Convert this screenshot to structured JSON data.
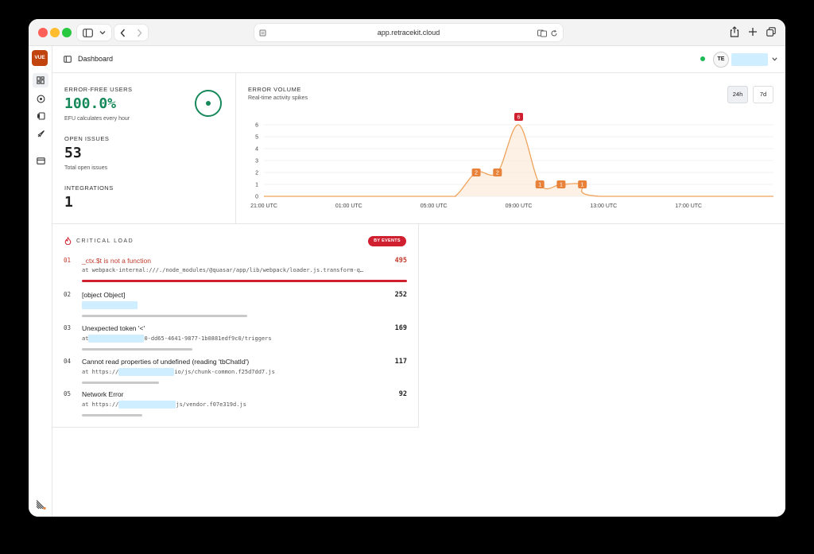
{
  "browser": {
    "url": "app.retracekit.cloud"
  },
  "sidebar": {
    "logo_text": "VUE"
  },
  "header": {
    "title": "Dashboard",
    "avatar_initials": "TE"
  },
  "stats": {
    "error_free": {
      "label": "ERROR-FREE USERS",
      "value": "100.0%",
      "sub": "EFU calculates every hour"
    },
    "open_issues": {
      "label": "OPEN ISSUES",
      "value": "53",
      "sub": "Total open issues"
    },
    "integrations": {
      "label": "INTEGRATIONS",
      "value": "1"
    }
  },
  "colors": {
    "accent_green": "#16885a",
    "danger_red": "#d01f2f",
    "chart_orange": "#f0a35a",
    "label_orange": "#e8823a"
  },
  "chart_panel": {
    "title": "ERROR VOLUME",
    "subtitle": "Real-time activity spikes",
    "ranges": [
      "24h",
      "7d"
    ],
    "selected_range": "24h"
  },
  "chart_data": {
    "type": "area",
    "title": "ERROR VOLUME",
    "subtitle": "Real-time activity spikes",
    "xlabel": "",
    "ylabel": "",
    "ylim": [
      0,
      6
    ],
    "yticks": [
      "0",
      "1",
      "2",
      "3",
      "4",
      "5",
      "6"
    ],
    "xticks": [
      "21:00 UTC",
      "01:00 UTC",
      "05:00 UTC",
      "09:00 UTC",
      "13:00 UTC",
      "17:00 UTC"
    ],
    "x": [
      "06:00",
      "07:00",
      "08:00",
      "09:00",
      "10:00",
      "11:00",
      "12:00"
    ],
    "values": [
      0,
      2,
      2,
      6,
      1,
      1,
      1
    ],
    "point_labels": [
      "2",
      "2",
      "6",
      "1",
      "1",
      "1"
    ],
    "grid": true,
    "legend": "none"
  },
  "critical": {
    "title": "CRITICAL LOAD",
    "badge": "BY EVENTS",
    "rows": [
      {
        "num": "01",
        "title": "_ctx.$t is not a function",
        "count": "495",
        "sub_prefix": "at webpack-internal:///./node_modules/@quasar/app/lib/webpack/loader.js.transform-q…",
        "sub_suffix": "",
        "share": 1.0
      },
      {
        "num": "02",
        "title": "[object Object]",
        "count": "252",
        "sub_prefix": "",
        "sub_suffix": "",
        "share": 0.509
      },
      {
        "num": "03",
        "title": "Unexpected token '<'",
        "count": "169",
        "sub_prefix": "at ",
        "sub_suffix": "0-dd65-4641-9877-1b0881edf9c0/triggers",
        "share": 0.341
      },
      {
        "num": "04",
        "title": "Cannot read properties of undefined (reading 'tbChatId')",
        "count": "117",
        "sub_prefix": "at https://",
        "sub_suffix": "io/js/chunk-common.f25d7dd7.js",
        "share": 0.236
      },
      {
        "num": "05",
        "title": "Network Error",
        "count": "92",
        "sub_prefix": "at https://",
        "sub_suffix": "js/vendor.f07e319d.js",
        "share": 0.186
      }
    ]
  }
}
